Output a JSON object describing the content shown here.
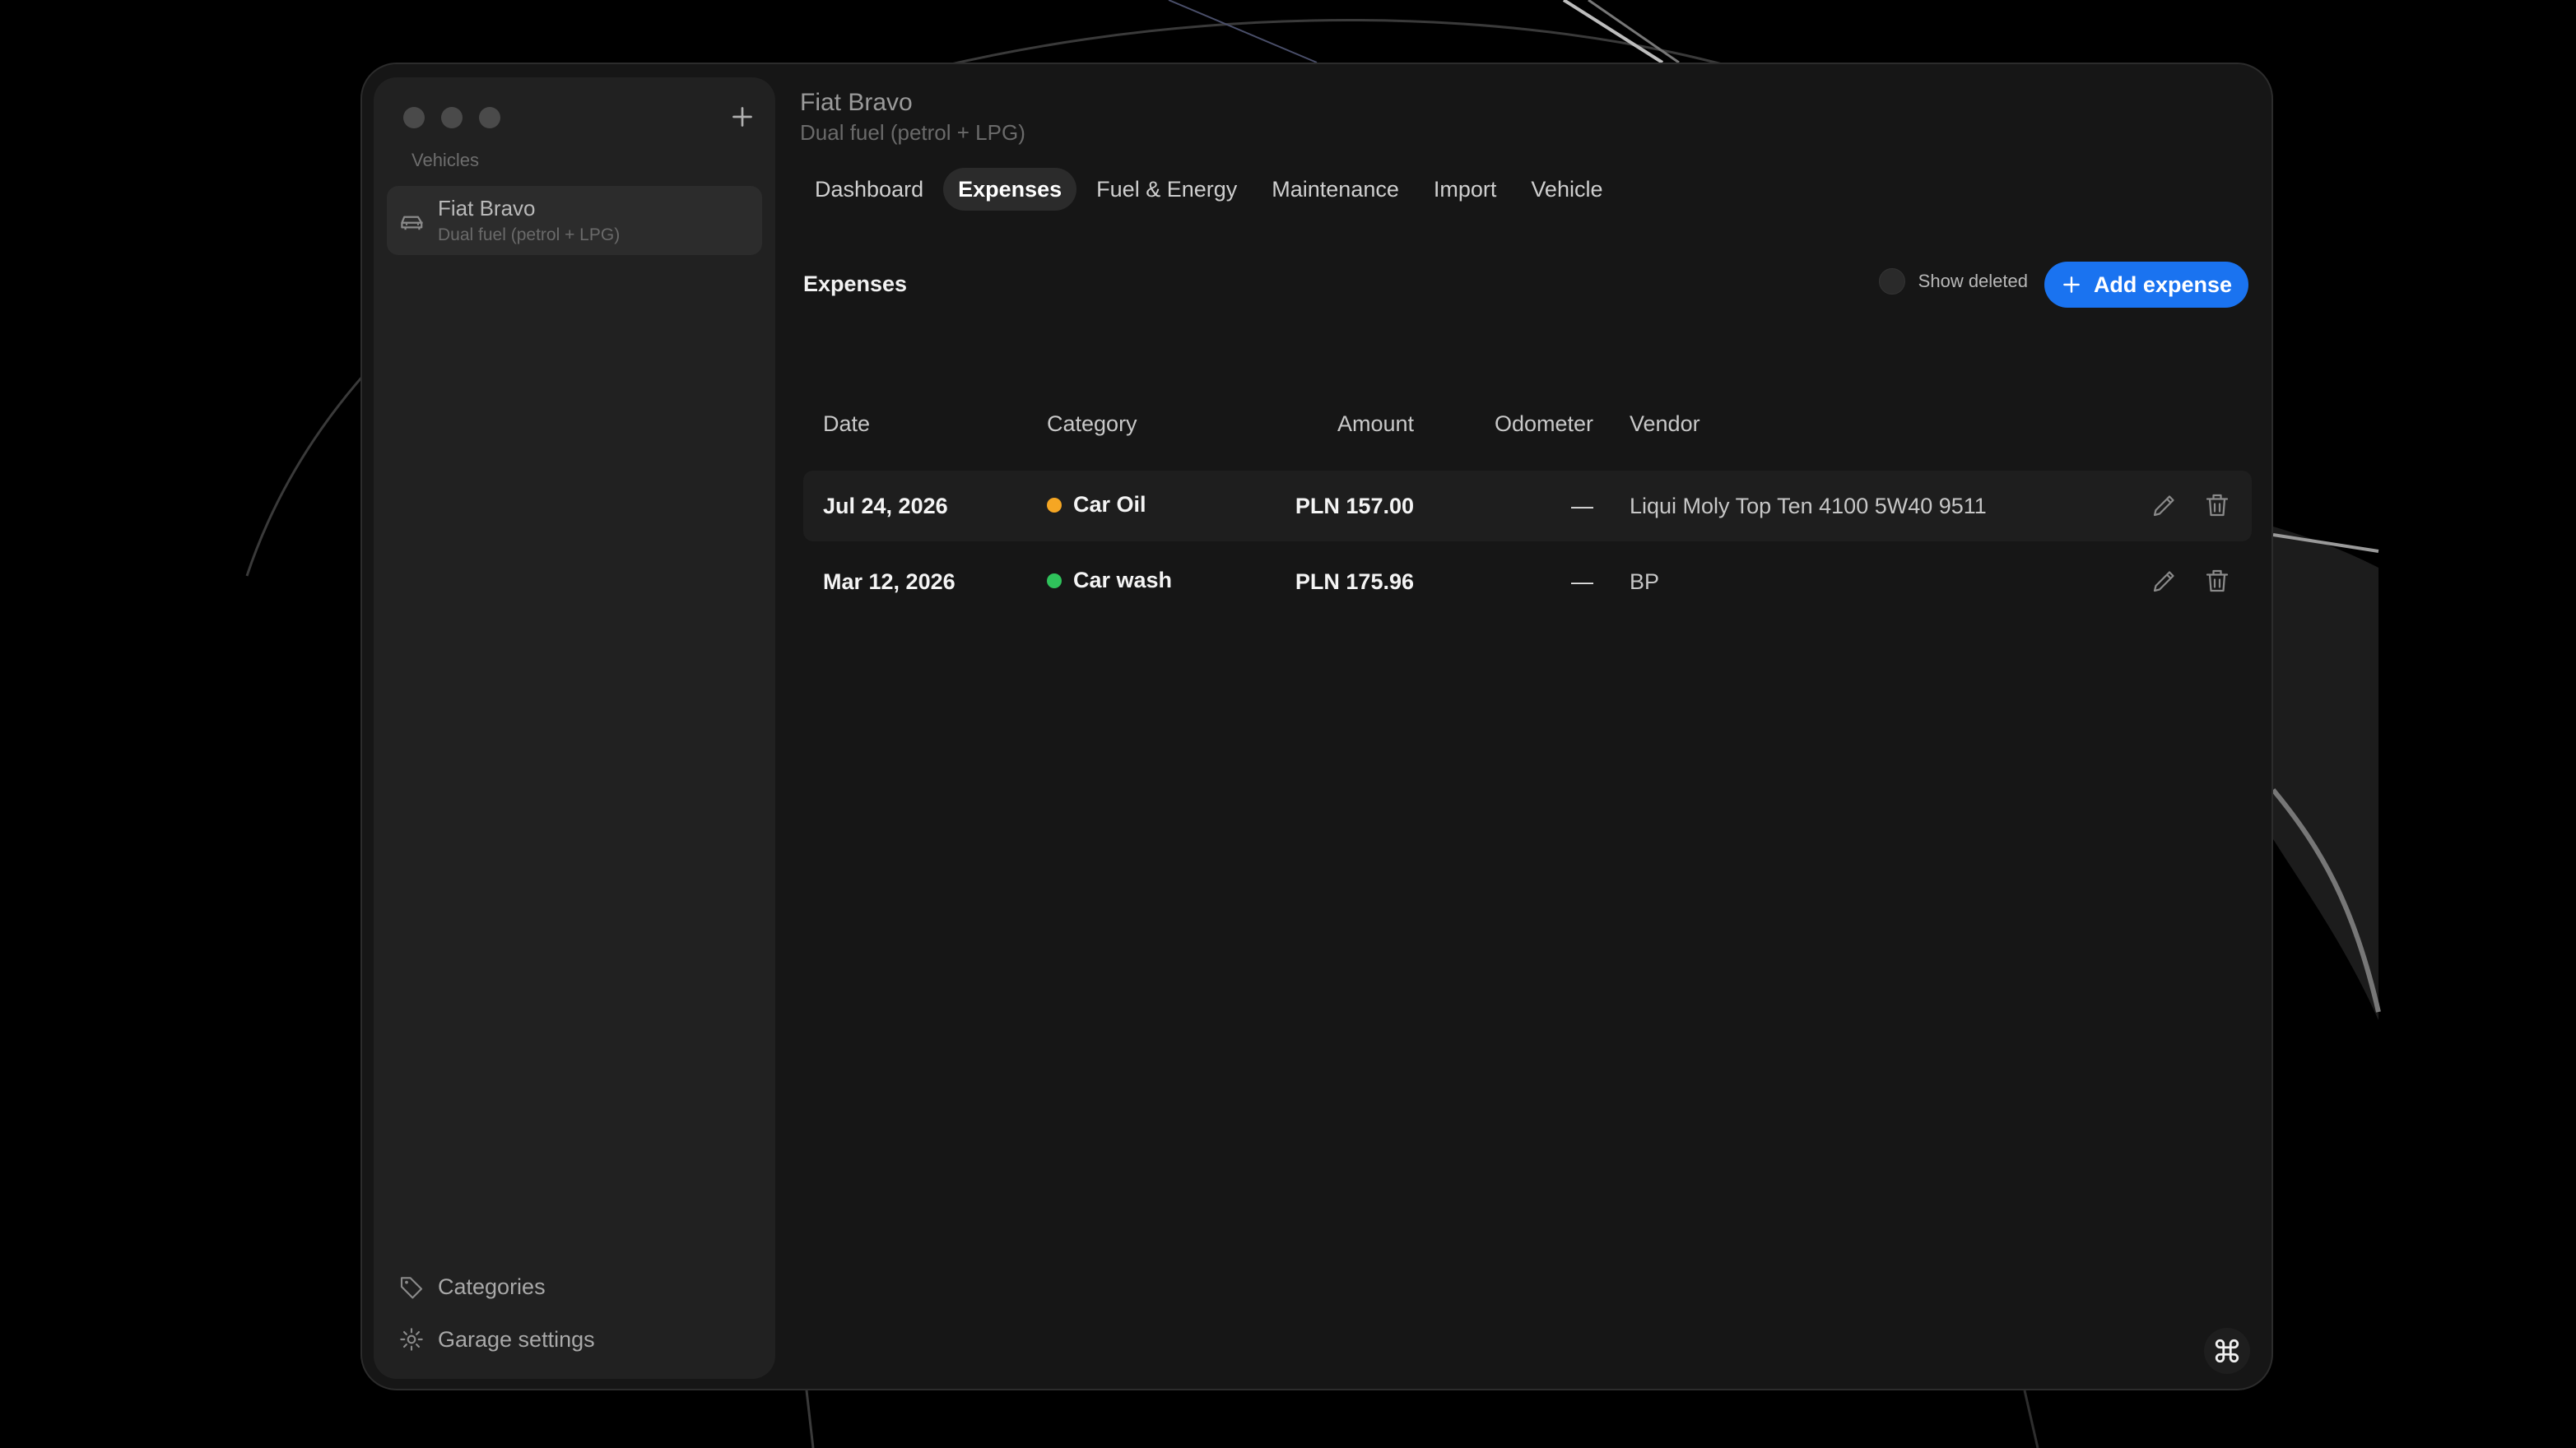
{
  "sidebar": {
    "section_label": "Vehicles",
    "vehicles": [
      {
        "name": "Fiat Bravo",
        "subtitle": "Dual fuel (petrol + LPG)",
        "icon": "car-icon"
      }
    ],
    "footer": [
      {
        "label": "Categories",
        "icon": "tag-icon"
      },
      {
        "label": "Garage settings",
        "icon": "gear-icon"
      }
    ]
  },
  "header": {
    "title": "Fiat Bravo",
    "subtitle": "Dual fuel (petrol + LPG)"
  },
  "tabs": [
    {
      "label": "Dashboard",
      "active": false
    },
    {
      "label": "Expenses",
      "active": true
    },
    {
      "label": "Fuel & Energy",
      "active": false
    },
    {
      "label": "Maintenance",
      "active": false
    },
    {
      "label": "Import",
      "active": false
    },
    {
      "label": "Vehicle",
      "active": false
    }
  ],
  "expenses": {
    "title": "Expenses",
    "show_deleted_label": "Show deleted",
    "show_deleted": false,
    "add_label": "Add expense",
    "columns": [
      "Date",
      "Category",
      "Amount",
      "Odometer",
      "Vendor"
    ],
    "rows": [
      {
        "date": "Jul 24, 2026",
        "category": "Car Oil",
        "category_color": "#f5a623",
        "amount": "PLN 157.00",
        "odometer": "—",
        "vendor": "Liqui Moly Top Ten 4100 5W40 9511"
      },
      {
        "date": "Mar 12, 2026",
        "category": "Car wash",
        "category_color": "#2fc25b",
        "amount": "PLN 175.96",
        "odometer": "—",
        "vendor": "BP"
      }
    ]
  },
  "colors": {
    "accent": "#1a73f0",
    "window_bg": "#161616",
    "sidebar_bg": "#212121"
  }
}
